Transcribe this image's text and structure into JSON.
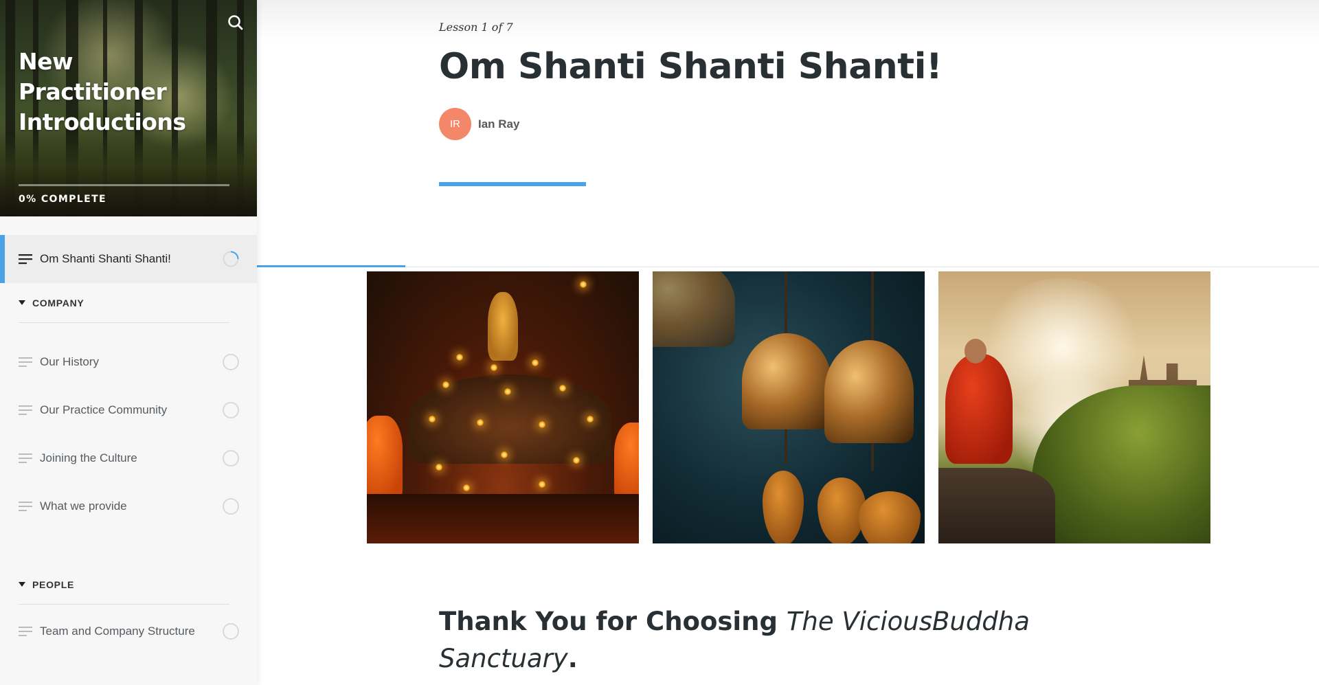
{
  "course": {
    "title": "New Practitioner Introductions",
    "progress_label": "0% COMPLETE",
    "progress_fraction": 0
  },
  "sidebar": {
    "active_lesson": {
      "label": "Om Shanti Shanti Shanti!",
      "icon": "lines-icon",
      "status": "in-progress"
    },
    "sections": [
      {
        "label": "COMPANY",
        "lessons": [
          {
            "label": "Our History"
          },
          {
            "label": "Our Practice Community"
          },
          {
            "label": "Joining the Culture"
          },
          {
            "label": "What we provide"
          }
        ]
      },
      {
        "label": "PEOPLE",
        "lessons": [
          {
            "label": "Team and Company Structure"
          }
        ]
      }
    ]
  },
  "lesson": {
    "counter": "Lesson 1 of 7",
    "title": "Om Shanti Shanti Shanti!",
    "author": {
      "initials": "IR",
      "name": "Ian Ray"
    }
  },
  "gallery": {
    "images": [
      "buddha-candles-photo",
      "temple-bells-photo",
      "monk-cliff-photo"
    ]
  },
  "content": {
    "heading_bold": "Thank You for Choosing",
    "heading_italic": "The ViciousBuddha Sanctuary",
    "heading_end": "."
  },
  "colors": {
    "accent": "#4aa3e8",
    "avatar": "#f4876a",
    "title": "#283034"
  }
}
